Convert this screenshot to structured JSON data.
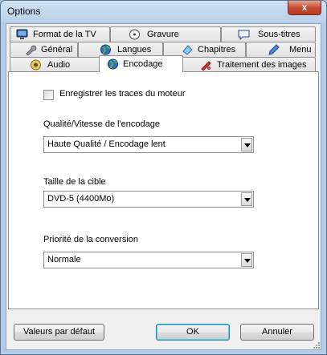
{
  "window": {
    "title": "Options",
    "close_symbol": "x"
  },
  "tabs_row1": [
    {
      "label": "Format de la TV",
      "icon": "tv-icon"
    },
    {
      "label": "Gravure",
      "icon": "disc-icon"
    },
    {
      "label": "Sous-titres",
      "icon": "speech-bubble-icon"
    }
  ],
  "tabs_row2": [
    {
      "label": "Général",
      "icon": "wrench-icon"
    },
    {
      "label": "Langues",
      "icon": "globe-icon"
    },
    {
      "label": "Chapitres",
      "icon": "chapter-icon"
    },
    {
      "label": "Menu",
      "icon": "pen-icon"
    }
  ],
  "tabs_row3": [
    {
      "label": "Audio",
      "icon": "speaker-icon"
    },
    {
      "label": "Encodage",
      "icon": "globe-icon",
      "active": true
    },
    {
      "label": "Traitement des images",
      "icon": "image-tools-icon"
    }
  ],
  "encodage": {
    "log_checkbox": {
      "label": "Enregistrer les traces du moteur",
      "checked": false
    },
    "quality": {
      "label": "Qualité/Vitesse de l'encodage",
      "value": "Haute Qualité / Encodage lent"
    },
    "target": {
      "label": "Taille de la cible",
      "value": "DVD-5 (4400Mo)"
    },
    "priority": {
      "label": "Priorité de la conversion",
      "value": "Normale"
    }
  },
  "buttons": {
    "defaults": "Valeurs par défaut",
    "ok": "OK",
    "cancel": "Annuler"
  }
}
